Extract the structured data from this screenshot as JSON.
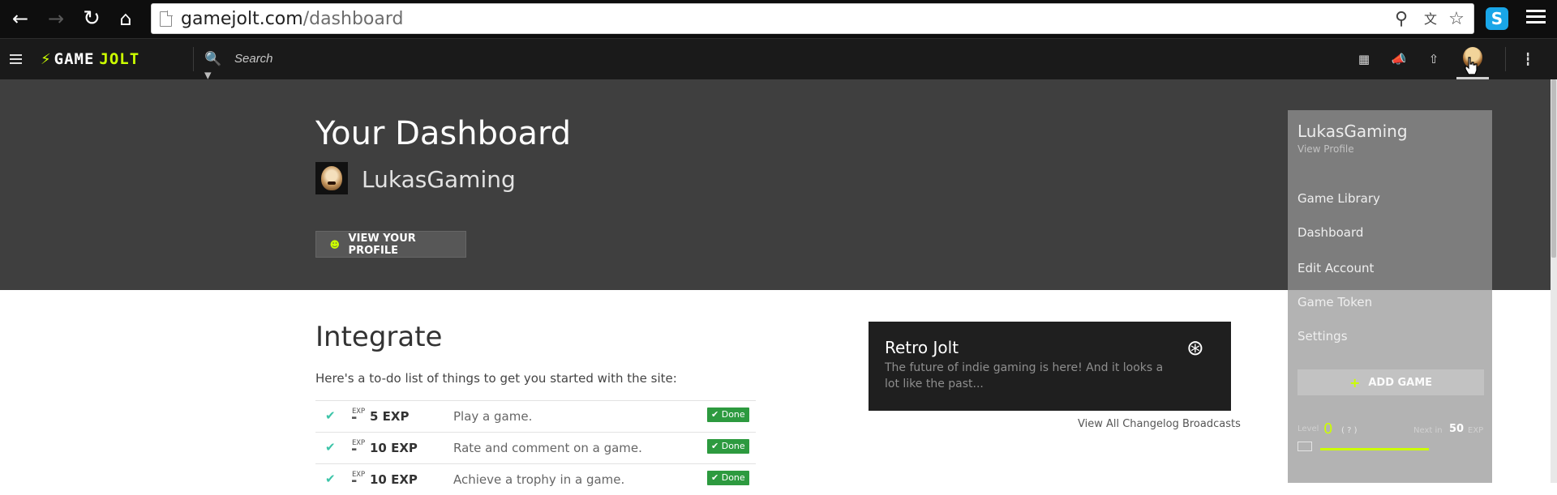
{
  "browser": {
    "url_host": "gamejolt.com",
    "url_path": "/dashboard"
  },
  "navbar": {
    "logo_word1": "GAME",
    "logo_word2": "JOLT",
    "search_placeholder": "Search"
  },
  "hero": {
    "title": "Your Dashboard",
    "username": "LukasGaming",
    "profile_button": "VIEW YOUR PROFILE"
  },
  "integrate": {
    "title": "Integrate",
    "description": "Here's a to-do list of things to get you started with the site:",
    "tasks": [
      {
        "exp": "5 EXP",
        "label": "Play a game.",
        "status": "Done"
      },
      {
        "exp": "10 EXP",
        "label": "Rate and comment on a game.",
        "status": "Done"
      },
      {
        "exp": "10 EXP",
        "label": "Achieve a trophy in a game.",
        "status": "Done"
      }
    ]
  },
  "retro": {
    "title": "Retro Jolt",
    "description": "The future of indie gaming is here! And it looks a lot like the past...",
    "changelog_link": "View All Changelog Broadcasts"
  },
  "user_menu": {
    "username": "LukasGaming",
    "view_profile": "View Profile",
    "items": [
      "Game Library",
      "Dashboard",
      "Edit Account",
      "Game Token",
      "Settings"
    ],
    "add_game": "ADD GAME",
    "level_label": "Level",
    "level_value": "0",
    "help": "?",
    "next_label": "Next in",
    "next_value": "50",
    "exp_label": "EXP"
  },
  "icons": {
    "browser_back": "arrow-left-icon",
    "browser_forward": "arrow-right-icon",
    "browser_reload": "reload-icon",
    "browser_home": "home-icon",
    "retro": "broadcast-tower-icon"
  },
  "colors": {
    "accent": "#ccff00",
    "done": "#2d9a3f",
    "check": "#3cc4a8",
    "hero_bg": "#3f3f3f",
    "nav_bg": "#1a1a1a"
  }
}
